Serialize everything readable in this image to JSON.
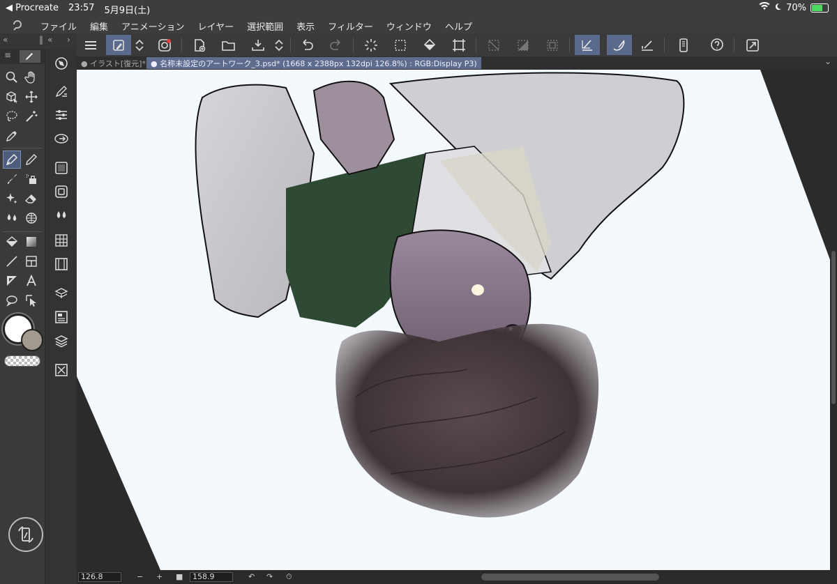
{
  "status_bar": {
    "back_label": "◀ Procreate",
    "time": "23:57",
    "date": "5月9日(土)",
    "battery_percent": "70%",
    "battery_level": 0.7
  },
  "menu": {
    "items": [
      "ファイル",
      "編集",
      "アニメーション",
      "レイヤー",
      "選択範囲",
      "表示",
      "フィルター",
      "ウィンドウ",
      "ヘルプ"
    ]
  },
  "tabs": [
    {
      "label": "● イラスト[復元]*",
      "active": false
    },
    {
      "label": "● 名称未設定のアートワーク_3.psd* (1668 x 2388px 132dpi 126.8%) : RGB:Display P3)",
      "active": true
    }
  ],
  "bottom_bar": {
    "zoom_value": "126.8",
    "minus_label": "−",
    "plus_label": "+",
    "rotation_value": "158.9"
  },
  "colors": {
    "accent": "#5a6a8c",
    "main_color": "#ffffff",
    "sub_color": "#a39a8f",
    "canvas_paper": "#f3f9fc"
  }
}
